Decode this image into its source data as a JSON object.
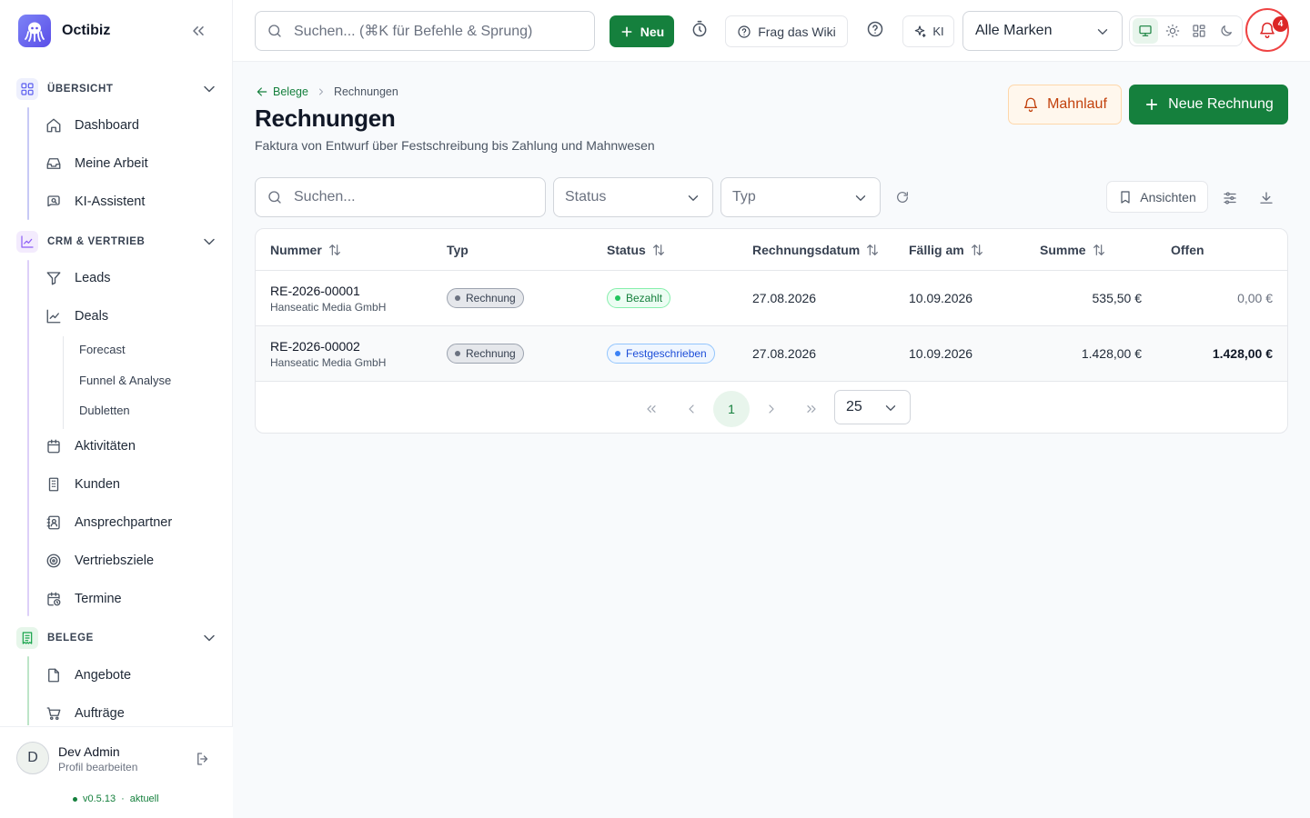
{
  "app": {
    "name": "Octibiz",
    "version": "v0.5.13",
    "version_status": "aktuell"
  },
  "sidebar": {
    "sections": [
      {
        "label": "ÜBERSICHT",
        "items": [
          "Dashboard",
          "Meine Arbeit",
          "KI-Assistent"
        ]
      },
      {
        "label": "CRM & VERTRIEB",
        "items": [
          "Leads",
          "Deals",
          "Aktivitäten",
          "Kunden",
          "Ansprechpartner",
          "Vertriebsziele",
          "Termine"
        ],
        "deals_sub": [
          "Forecast",
          "Funnel & Analyse",
          "Dubletten"
        ]
      },
      {
        "label": "BELEGE",
        "items": [
          "Angebote",
          "Aufträge"
        ]
      }
    ],
    "user": {
      "initial": "D",
      "name": "Dev Admin",
      "sub": "Profil bearbeiten"
    }
  },
  "topbar": {
    "search_placeholder": "Suchen... (⌘K für Befehle & Sprung)",
    "new_label": "Neu",
    "wiki_label": "Frag das Wiki",
    "ki_label": "KI",
    "brand_filter": "Alle Marken",
    "notification_count": "4"
  },
  "page": {
    "breadcrumb_parent": "Belege",
    "breadcrumb_current": "Rechnungen",
    "title": "Rechnungen",
    "subtitle": "Faktura von Entwurf über Festschreibung bis Zahlung und Mahnwesen",
    "btn_dunning": "Mahnlauf",
    "btn_new_invoice": "Neue Rechnung"
  },
  "filters": {
    "search_placeholder": "Suchen...",
    "status_placeholder": "Status",
    "type_placeholder": "Typ",
    "views_label": "Ansichten"
  },
  "table": {
    "columns": [
      "Nummer",
      "Typ",
      "Status",
      "Rechnungsdatum",
      "Fällig am",
      "Summe",
      "Offen"
    ],
    "rows": [
      {
        "number": "RE-2026-00001",
        "customer": "Hanseatic Media GmbH",
        "type": "Rechnung",
        "status": "Bezahlt",
        "date": "27.08.2026",
        "due": "10.09.2026",
        "sum": "535,50 €",
        "open": "0,00 €"
      },
      {
        "number": "RE-2026-00002",
        "customer": "Hanseatic Media GmbH",
        "type": "Rechnung",
        "status": "Festgeschrieben",
        "date": "27.08.2026",
        "due": "10.09.2026",
        "sum": "1.428,00 €",
        "open": "1.428,00 €"
      }
    ]
  },
  "pagination": {
    "current_page": "1",
    "page_size": "25"
  },
  "colors": {
    "primary": "#15803d",
    "dunning": "#c2410c",
    "notification": "#dc2626"
  }
}
